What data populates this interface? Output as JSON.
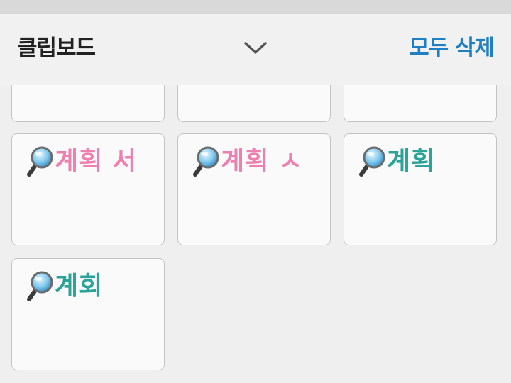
{
  "header": {
    "title": "클립보드",
    "clear_all_label": "모두 삭제",
    "collapse_icon": "chevron-down-icon"
  },
  "colors": {
    "pink_text": "#ee7fae",
    "teal_text": "#2aa399",
    "clear_all": "#1f7fc4"
  },
  "clips": [
    {
      "text": "",
      "icon": "",
      "color": ""
    },
    {
      "text": "",
      "icon": "",
      "color": ""
    },
    {
      "text": "",
      "icon": "",
      "color": ""
    },
    {
      "text": "계획 서",
      "icon": "magnifier-icon",
      "color": "pink"
    },
    {
      "text": "계획 ㅅ",
      "icon": "magnifier-icon",
      "color": "pink"
    },
    {
      "text": "계획",
      "icon": "magnifier-icon",
      "color": "teal"
    },
    {
      "text": "계회",
      "icon": "magnifier-icon",
      "color": "teal"
    }
  ]
}
